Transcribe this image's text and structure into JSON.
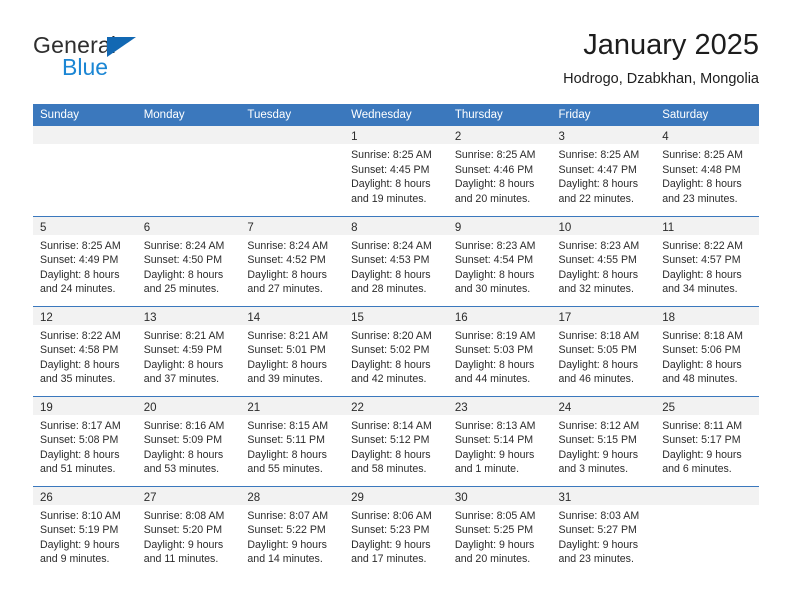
{
  "brand": {
    "name_part1": "General",
    "name_part2": "Blue",
    "triangle_color": "#1268b3",
    "blue_color": "#1b86d4"
  },
  "header": {
    "title": "January 2025",
    "subtitle": "Hodrogo, Dzabkhan, Mongolia"
  },
  "theme": {
    "header_bg": "#3b78bd",
    "daynum_band_bg": "#f2f2f2",
    "grid_line": "#3b78bd",
    "text": "#2b2b2b"
  },
  "weekdays": [
    "Sunday",
    "Monday",
    "Tuesday",
    "Wednesday",
    "Thursday",
    "Friday",
    "Saturday"
  ],
  "weeks": [
    [
      {
        "day": "",
        "lines": []
      },
      {
        "day": "",
        "lines": []
      },
      {
        "day": "",
        "lines": []
      },
      {
        "day": "1",
        "lines": [
          "Sunrise: 8:25 AM",
          "Sunset: 4:45 PM",
          "Daylight: 8 hours",
          "and 19 minutes."
        ]
      },
      {
        "day": "2",
        "lines": [
          "Sunrise: 8:25 AM",
          "Sunset: 4:46 PM",
          "Daylight: 8 hours",
          "and 20 minutes."
        ]
      },
      {
        "day": "3",
        "lines": [
          "Sunrise: 8:25 AM",
          "Sunset: 4:47 PM",
          "Daylight: 8 hours",
          "and 22 minutes."
        ]
      },
      {
        "day": "4",
        "lines": [
          "Sunrise: 8:25 AM",
          "Sunset: 4:48 PM",
          "Daylight: 8 hours",
          "and 23 minutes."
        ]
      }
    ],
    [
      {
        "day": "5",
        "lines": [
          "Sunrise: 8:25 AM",
          "Sunset: 4:49 PM",
          "Daylight: 8 hours",
          "and 24 minutes."
        ]
      },
      {
        "day": "6",
        "lines": [
          "Sunrise: 8:24 AM",
          "Sunset: 4:50 PM",
          "Daylight: 8 hours",
          "and 25 minutes."
        ]
      },
      {
        "day": "7",
        "lines": [
          "Sunrise: 8:24 AM",
          "Sunset: 4:52 PM",
          "Daylight: 8 hours",
          "and 27 minutes."
        ]
      },
      {
        "day": "8",
        "lines": [
          "Sunrise: 8:24 AM",
          "Sunset: 4:53 PM",
          "Daylight: 8 hours",
          "and 28 minutes."
        ]
      },
      {
        "day": "9",
        "lines": [
          "Sunrise: 8:23 AM",
          "Sunset: 4:54 PM",
          "Daylight: 8 hours",
          "and 30 minutes."
        ]
      },
      {
        "day": "10",
        "lines": [
          "Sunrise: 8:23 AM",
          "Sunset: 4:55 PM",
          "Daylight: 8 hours",
          "and 32 minutes."
        ]
      },
      {
        "day": "11",
        "lines": [
          "Sunrise: 8:22 AM",
          "Sunset: 4:57 PM",
          "Daylight: 8 hours",
          "and 34 minutes."
        ]
      }
    ],
    [
      {
        "day": "12",
        "lines": [
          "Sunrise: 8:22 AM",
          "Sunset: 4:58 PM",
          "Daylight: 8 hours",
          "and 35 minutes."
        ]
      },
      {
        "day": "13",
        "lines": [
          "Sunrise: 8:21 AM",
          "Sunset: 4:59 PM",
          "Daylight: 8 hours",
          "and 37 minutes."
        ]
      },
      {
        "day": "14",
        "lines": [
          "Sunrise: 8:21 AM",
          "Sunset: 5:01 PM",
          "Daylight: 8 hours",
          "and 39 minutes."
        ]
      },
      {
        "day": "15",
        "lines": [
          "Sunrise: 8:20 AM",
          "Sunset: 5:02 PM",
          "Daylight: 8 hours",
          "and 42 minutes."
        ]
      },
      {
        "day": "16",
        "lines": [
          "Sunrise: 8:19 AM",
          "Sunset: 5:03 PM",
          "Daylight: 8 hours",
          "and 44 minutes."
        ]
      },
      {
        "day": "17",
        "lines": [
          "Sunrise: 8:18 AM",
          "Sunset: 5:05 PM",
          "Daylight: 8 hours",
          "and 46 minutes."
        ]
      },
      {
        "day": "18",
        "lines": [
          "Sunrise: 8:18 AM",
          "Sunset: 5:06 PM",
          "Daylight: 8 hours",
          "and 48 minutes."
        ]
      }
    ],
    [
      {
        "day": "19",
        "lines": [
          "Sunrise: 8:17 AM",
          "Sunset: 5:08 PM",
          "Daylight: 8 hours",
          "and 51 minutes."
        ]
      },
      {
        "day": "20",
        "lines": [
          "Sunrise: 8:16 AM",
          "Sunset: 5:09 PM",
          "Daylight: 8 hours",
          "and 53 minutes."
        ]
      },
      {
        "day": "21",
        "lines": [
          "Sunrise: 8:15 AM",
          "Sunset: 5:11 PM",
          "Daylight: 8 hours",
          "and 55 minutes."
        ]
      },
      {
        "day": "22",
        "lines": [
          "Sunrise: 8:14 AM",
          "Sunset: 5:12 PM",
          "Daylight: 8 hours",
          "and 58 minutes."
        ]
      },
      {
        "day": "23",
        "lines": [
          "Sunrise: 8:13 AM",
          "Sunset: 5:14 PM",
          "Daylight: 9 hours",
          "and 1 minute."
        ]
      },
      {
        "day": "24",
        "lines": [
          "Sunrise: 8:12 AM",
          "Sunset: 5:15 PM",
          "Daylight: 9 hours",
          "and 3 minutes."
        ]
      },
      {
        "day": "25",
        "lines": [
          "Sunrise: 8:11 AM",
          "Sunset: 5:17 PM",
          "Daylight: 9 hours",
          "and 6 minutes."
        ]
      }
    ],
    [
      {
        "day": "26",
        "lines": [
          "Sunrise: 8:10 AM",
          "Sunset: 5:19 PM",
          "Daylight: 9 hours",
          "and 9 minutes."
        ]
      },
      {
        "day": "27",
        "lines": [
          "Sunrise: 8:08 AM",
          "Sunset: 5:20 PM",
          "Daylight: 9 hours",
          "and 11 minutes."
        ]
      },
      {
        "day": "28",
        "lines": [
          "Sunrise: 8:07 AM",
          "Sunset: 5:22 PM",
          "Daylight: 9 hours",
          "and 14 minutes."
        ]
      },
      {
        "day": "29",
        "lines": [
          "Sunrise: 8:06 AM",
          "Sunset: 5:23 PM",
          "Daylight: 9 hours",
          "and 17 minutes."
        ]
      },
      {
        "day": "30",
        "lines": [
          "Sunrise: 8:05 AM",
          "Sunset: 5:25 PM",
          "Daylight: 9 hours",
          "and 20 minutes."
        ]
      },
      {
        "day": "31",
        "lines": [
          "Sunrise: 8:03 AM",
          "Sunset: 5:27 PM",
          "Daylight: 9 hours",
          "and 23 minutes."
        ]
      },
      {
        "day": "",
        "lines": []
      }
    ]
  ]
}
